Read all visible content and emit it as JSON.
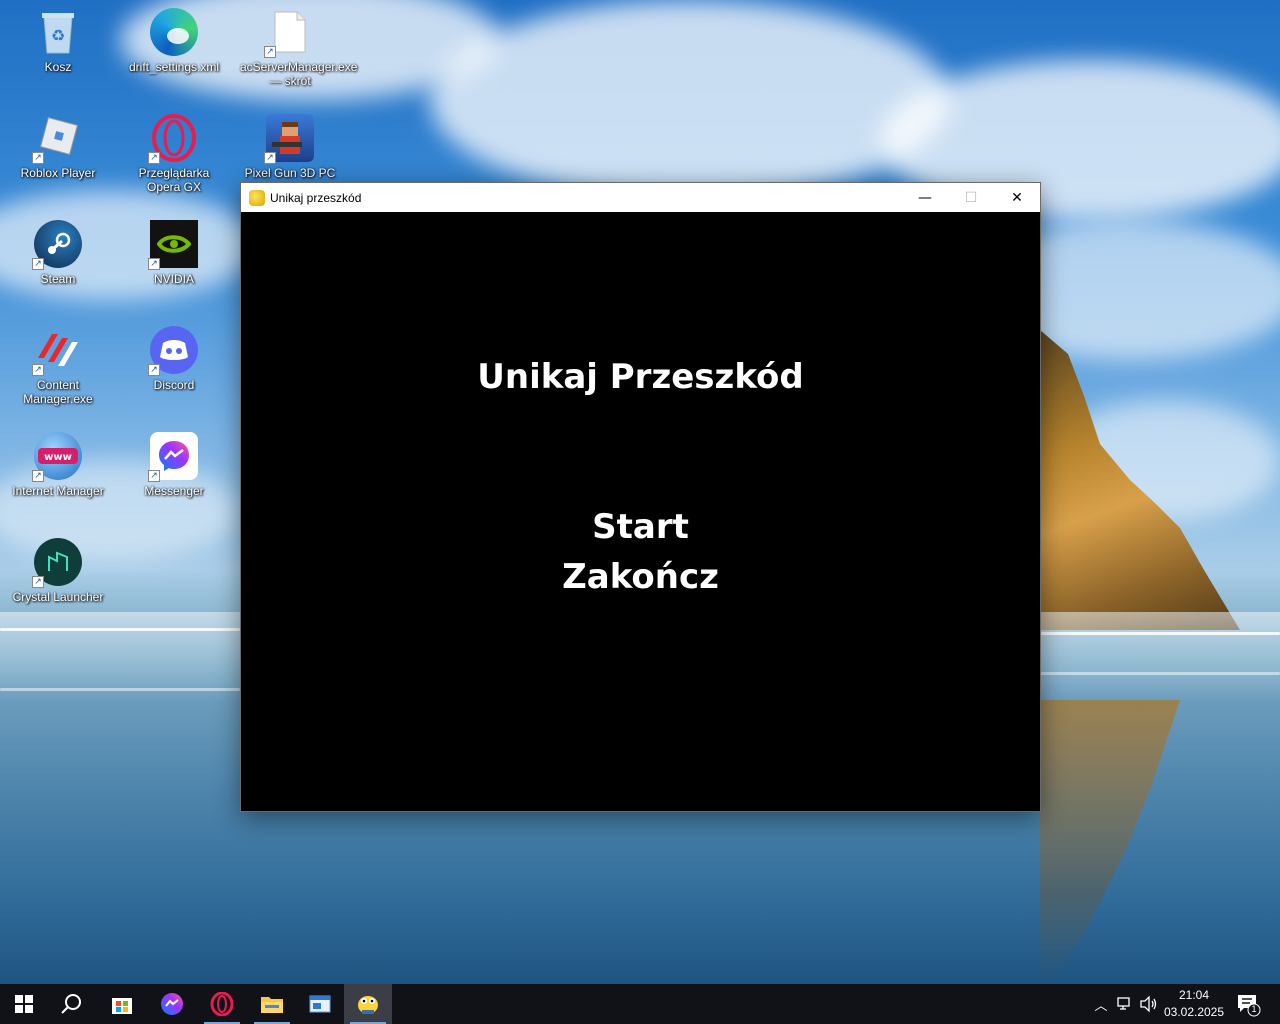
{
  "desktop": {
    "icons": [
      {
        "label": "Kosz",
        "icon": "recycle-bin-icon"
      },
      {
        "label": "drift_settings.xml",
        "icon": "edge-icon"
      },
      {
        "label": "acServerManager.exe — skrót",
        "icon": "file-icon"
      },
      {
        "label": "Roblox Player",
        "icon": "roblox-icon"
      },
      {
        "label": "Przeglądarka Opera GX",
        "icon": "opera-gx-icon"
      },
      {
        "label": "Pixel Gun 3D PC",
        "icon": "pixel-gun-icon"
      },
      {
        "label": "Steam",
        "icon": "steam-icon"
      },
      {
        "label": "NVIDIA",
        "icon": "nvidia-icon"
      },
      {
        "label": "Content Manager.exe",
        "icon": "content-manager-icon"
      },
      {
        "label": "Discord",
        "icon": "discord-icon"
      },
      {
        "label": "Internet Manager",
        "icon": "internet-manager-icon"
      },
      {
        "label": "Messenger",
        "icon": "messenger-icon"
      },
      {
        "label": "Crystal Launcher",
        "icon": "crystal-launcher-icon"
      }
    ]
  },
  "window": {
    "title": "Unikaj przeszkód",
    "controls": {
      "minimize": "—",
      "maximize": "☐",
      "close": "✕"
    }
  },
  "game": {
    "heading": "Unikaj Przeszkód",
    "menu": {
      "start": "Start",
      "quit": "Zakończ"
    }
  },
  "taskbar": {
    "apps": [
      "start-icon",
      "search-icon",
      "store-icon",
      "messenger-icon",
      "opera-icon",
      "file-explorer-icon",
      "app-window-icon",
      "pygame-icon"
    ],
    "clock": {
      "time": "21:04",
      "date": "03.02.2025"
    },
    "notifications_count": "1"
  }
}
